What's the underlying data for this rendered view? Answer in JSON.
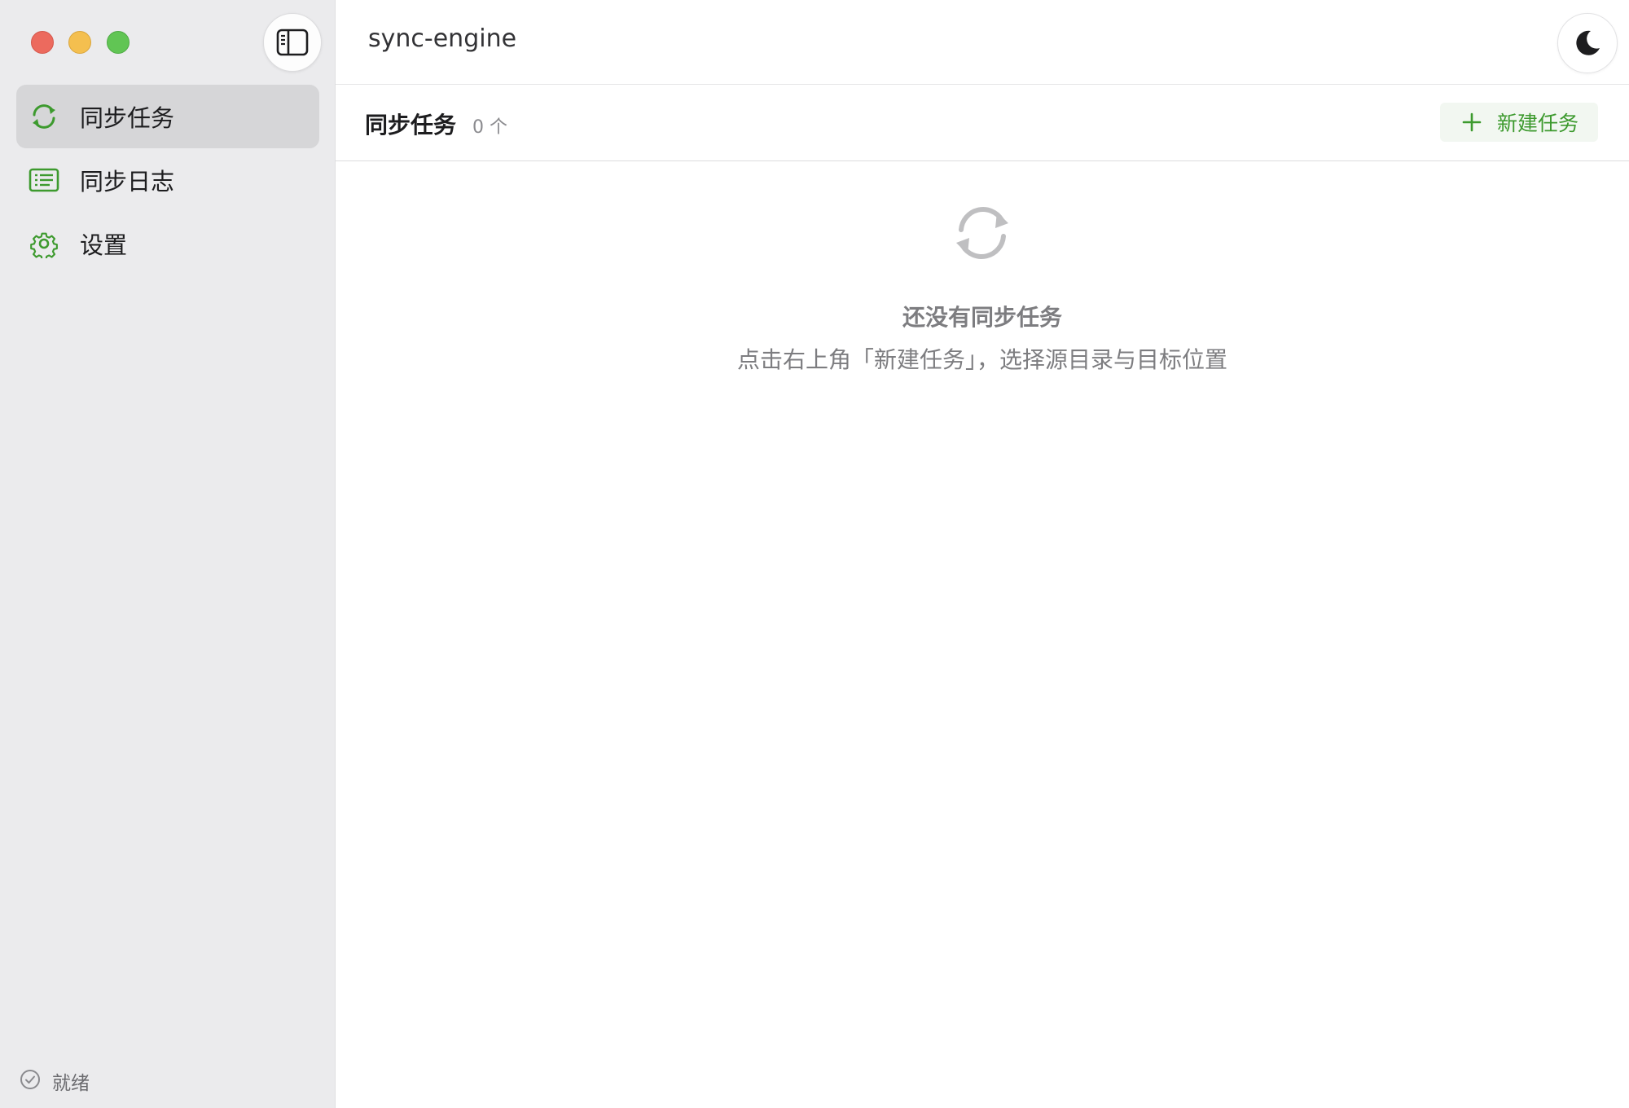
{
  "app": {
    "title": "sync-engine"
  },
  "sidebar": {
    "items": [
      {
        "label": "同步任务",
        "icon": "sync-icon",
        "active": true
      },
      {
        "label": "同步日志",
        "icon": "log-list-icon",
        "active": false
      },
      {
        "label": "设置",
        "icon": "gear-icon",
        "active": false
      }
    ],
    "status": {
      "label": "就绪",
      "icon": "check-circle-icon"
    }
  },
  "section": {
    "title": "同步任务",
    "count": "0 个",
    "new_task_label": "新建任务"
  },
  "empty_state": {
    "icon": "sync-icon",
    "title": "还没有同步任务",
    "description": "点击右上角「新建任务」，选择源目录与目标位置"
  },
  "colors": {
    "accent": "#3d9a2e",
    "sidebar_bg": "#ebebed",
    "active_item_bg": "#d6d6d8",
    "traffic_close": "#ec6a5e",
    "traffic_minimize": "#f4bf4f",
    "traffic_maximize": "#61c554"
  }
}
